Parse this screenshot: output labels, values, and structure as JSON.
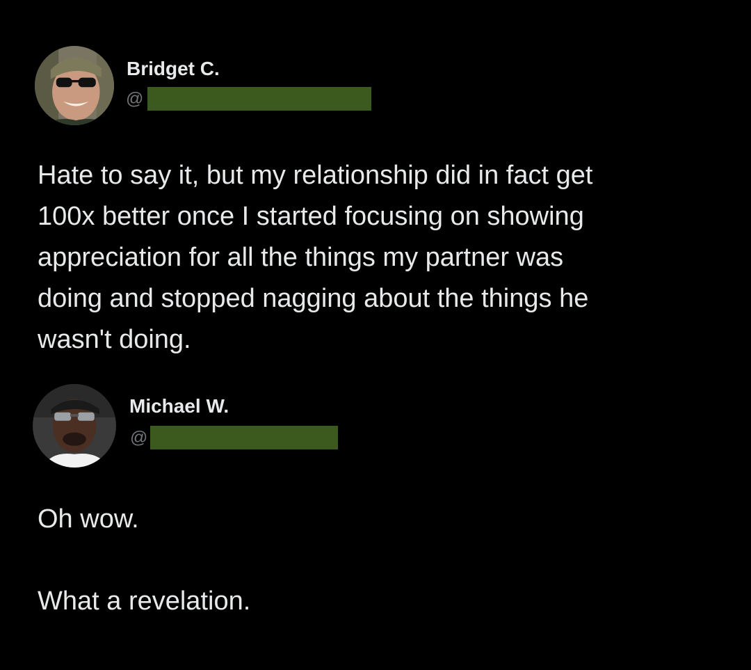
{
  "posts": [
    {
      "author": "Bridget C.",
      "handle_prefix": "@",
      "body_lines": [
        "Hate to say it, but my relationship did in fact get",
        "100x better once I started focusing on showing",
        "appreciation for all the things my partner was",
        "doing and stopped nagging about the things he",
        "wasn't doing."
      ]
    },
    {
      "author": "Michael W.",
      "handle_prefix": "@",
      "body_lines": [
        "Oh wow.",
        "What a revelation."
      ]
    }
  ],
  "colors": {
    "background": "#000000",
    "text": "#e7e9ea",
    "muted": "#71767b",
    "redaction": "#3d5a1e"
  },
  "icons": {
    "avatar_1": "avatar-woman-sunglasses",
    "avatar_2": "avatar-man-sunglasses"
  }
}
